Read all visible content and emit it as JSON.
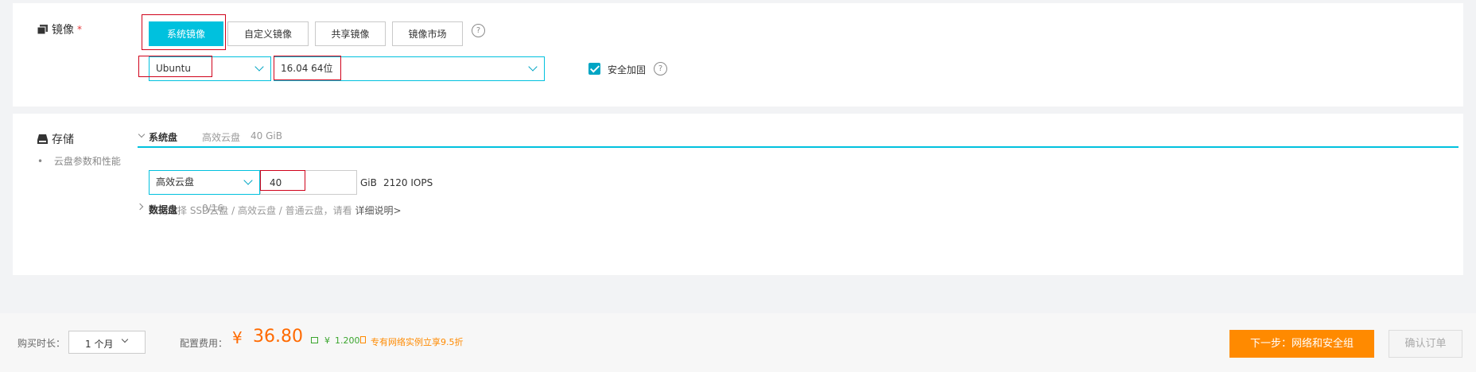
{
  "image": {
    "section_label": "镜像",
    "required_mark": "*",
    "tabs": [
      {
        "label": "系统镜像",
        "active": true
      },
      {
        "label": "自定义镜像",
        "active": false
      },
      {
        "label": "共享镜像",
        "active": false
      },
      {
        "label": "镜像市场",
        "active": false
      }
    ],
    "help_glyph": "?",
    "os_select": {
      "value": "Ubuntu"
    },
    "version_select": {
      "value": "16.04 64位"
    },
    "security": {
      "checked": true,
      "label": "安全加固"
    }
  },
  "storage": {
    "section_label": "存储",
    "sub_bullet": "•",
    "sub_label": "云盘参数和性能",
    "system_disk": {
      "title": "系统盘",
      "summary_type": "高效云盘",
      "summary_size": "40 GiB",
      "type_select": {
        "value": "高效云盘"
      },
      "size_input": {
        "value": "40"
      },
      "unit": "GiB",
      "iops": "2120 IOPS",
      "hint": "如何选择 SSD云盘 / 高效云盘 / 普通云盘，请看",
      "hint_link": "详细说明>"
    },
    "data_disk": {
      "title": "数据盘",
      "count": "0/16"
    }
  },
  "footer": {
    "duration_label": "购买时长：",
    "duration_value": "1 个月",
    "fee_label": "配置费用：",
    "currency": "¥",
    "price": "36.80",
    "traffic_currency": "¥",
    "traffic_price": "1.200",
    "promo": "专有网络实例立享9.5折",
    "next_button": "下一步：网络和安全组",
    "confirm_button": "确认订单"
  },
  "colors": {
    "accent": "#00c1de",
    "highlight": "#d0021b",
    "price": "#ff6a00",
    "primary_button": "#ff8a00",
    "traffic": "#3aa52d"
  }
}
